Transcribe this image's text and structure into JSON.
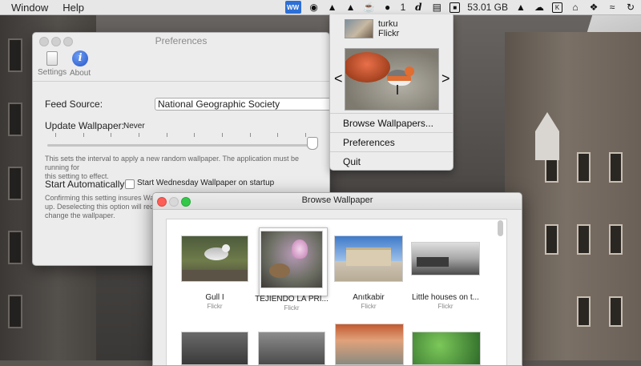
{
  "menubar": {
    "menus": [
      "Window",
      "Help"
    ],
    "status": {
      "active_app": "WW",
      "badge_count": "1",
      "italic_glyph": "d",
      "storage": "53.01 GB"
    }
  },
  "dropdown": {
    "photo_title": "turku",
    "photo_source": "Flickr",
    "prev_arrow": "<",
    "next_arrow": ">",
    "items": [
      "Browse Wallpapers...",
      "Preferences",
      "Quit"
    ]
  },
  "preferences": {
    "title": "Preferences",
    "toolbar": [
      "Settings",
      "About"
    ],
    "about_glyph": "i",
    "feed_label": "Feed Source:",
    "feed_value": "National Geographic Society",
    "update_label": "Update Wallpaper:",
    "update_value": "Never",
    "slider_fraction": 1.0,
    "update_help_1": "This sets the interval to apply a new random wallpaper.  The application must be running for",
    "update_help_2": "this setting to effect.",
    "auto_label": "Start Automatically:",
    "auto_checkbox_label": "Start Wednesday Wallpaper on startup",
    "auto_checked": false,
    "auto_help_1": "Confirming this setting insures Wallp",
    "auto_help_2": "up.  Deselecting this option will requ",
    "auto_help_3": "change the wallpaper."
  },
  "browse": {
    "title": "Browse Wallpaper",
    "items": [
      {
        "title": "Gull I",
        "source": "Flickr"
      },
      {
        "title": "TEJIENDO LA PRI...",
        "source": "Flickr"
      },
      {
        "title": "Anıtkabir",
        "source": "Flickr"
      },
      {
        "title": "Little houses on t...",
        "source": "Flickr"
      }
    ]
  }
}
